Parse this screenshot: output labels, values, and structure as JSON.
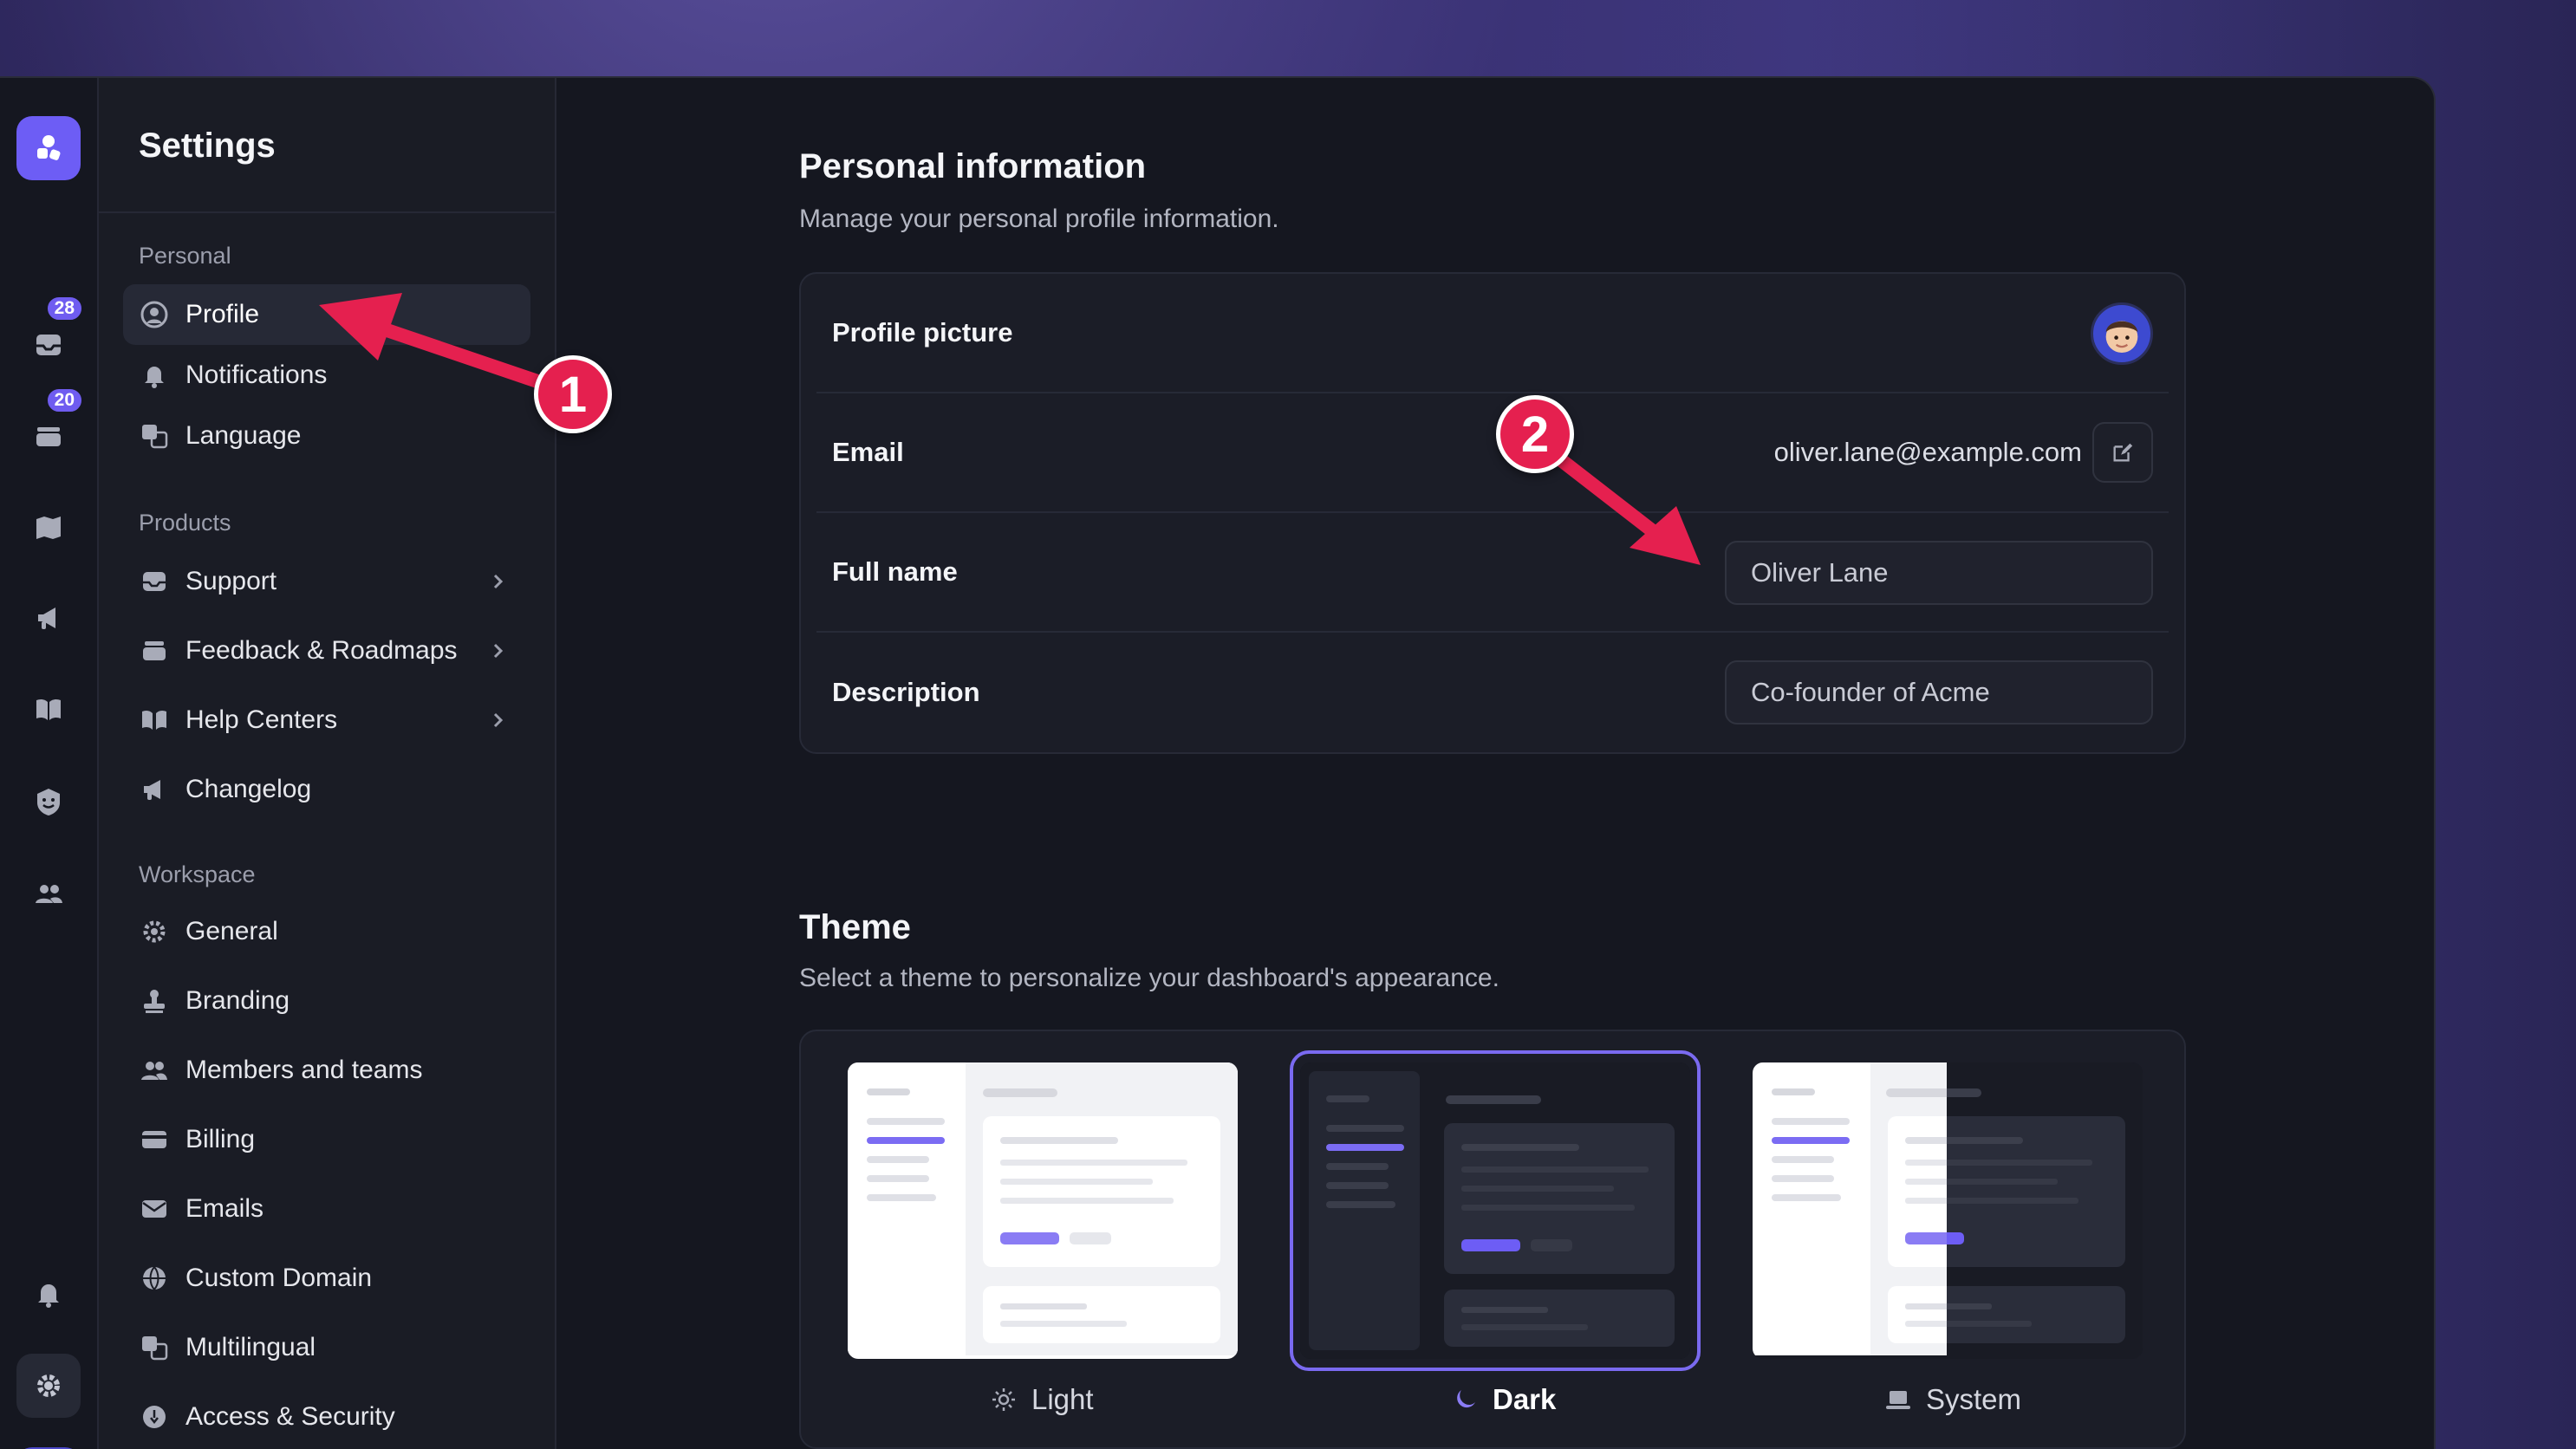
{
  "sidebar": {
    "title": "Settings",
    "sections": {
      "personal": "Personal",
      "products": "Products",
      "workspace": "Workspace"
    },
    "personal_items": [
      {
        "label": "Profile",
        "icon": "user-circle-icon"
      },
      {
        "label": "Notifications",
        "icon": "bell-icon"
      },
      {
        "label": "Language",
        "icon": "translate-icon"
      }
    ],
    "product_items": [
      {
        "label": "Support",
        "icon": "inbox-icon"
      },
      {
        "label": "Feedback & Roadmaps",
        "icon": "stack-icon"
      },
      {
        "label": "Help Centers",
        "icon": "book-icon"
      },
      {
        "label": "Changelog",
        "icon": "megaphone-icon"
      }
    ],
    "workspace_items": [
      {
        "label": "General",
        "icon": "gear-icon"
      },
      {
        "label": "Branding",
        "icon": "stamp-icon"
      },
      {
        "label": "Members and teams",
        "icon": "users-icon"
      },
      {
        "label": "Billing",
        "icon": "credit-card-icon"
      },
      {
        "label": "Emails",
        "icon": "envelope-icon"
      },
      {
        "label": "Custom Domain",
        "icon": "globe-icon"
      },
      {
        "label": "Multilingual",
        "icon": "translate-icon"
      },
      {
        "label": "Access & Security",
        "icon": "shield-icon"
      }
    ]
  },
  "rail": {
    "inbox_badge": "28",
    "feedback_badge": "20"
  },
  "personal_info": {
    "title": "Personal information",
    "subtitle": "Manage your personal profile information.",
    "profile_picture_label": "Profile picture",
    "email_label": "Email",
    "email_value": "oliver.lane@example.com",
    "full_name_label": "Full name",
    "full_name_value": "Oliver Lane",
    "description_label": "Description",
    "description_value": "Co-founder of Acme"
  },
  "theme": {
    "title": "Theme",
    "subtitle": "Select a theme to personalize your dashboard's appearance.",
    "options": [
      {
        "label": "Light",
        "icon": "sun-icon"
      },
      {
        "label": "Dark",
        "icon": "moon-icon"
      },
      {
        "label": "System",
        "icon": "laptop-icon"
      }
    ],
    "selected": "Dark"
  },
  "annotations": [
    "1",
    "2"
  ],
  "colors": {
    "accent": "#6d5df5",
    "annotation": "#e5204f",
    "background": "#151720"
  }
}
